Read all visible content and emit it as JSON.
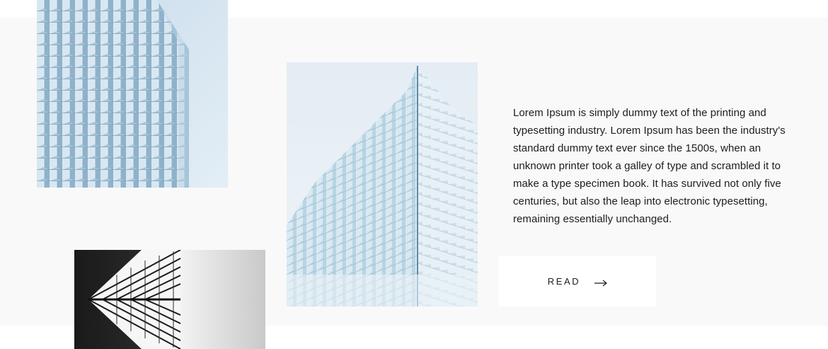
{
  "article": {
    "text": "Lorem Ipsum is simply dummy text of the printing and typesetting industry. Lorem Ipsum has been the industry's standard dummy text ever since the 1500s, when an unknown printer took a galley of type and scrambled it to make a type specimen book. It has survived not only five centuries, but also the leap into electronic typesetting, remaining essentially unchanged.",
    "read_label": "READ",
    "read_icon": "arrow-right-icon"
  },
  "images": [
    {
      "name": "glass-facade-photo",
      "palette": "light-blue"
    },
    {
      "name": "glass-tower-corner-photo",
      "palette": "light-blue"
    },
    {
      "name": "monochrome-skyscraper-photo",
      "palette": "black-white"
    }
  ],
  "colors": {
    "band_background": "#f9f9f9",
    "text": "#1d1d1d",
    "button_background": "#ffffff"
  }
}
